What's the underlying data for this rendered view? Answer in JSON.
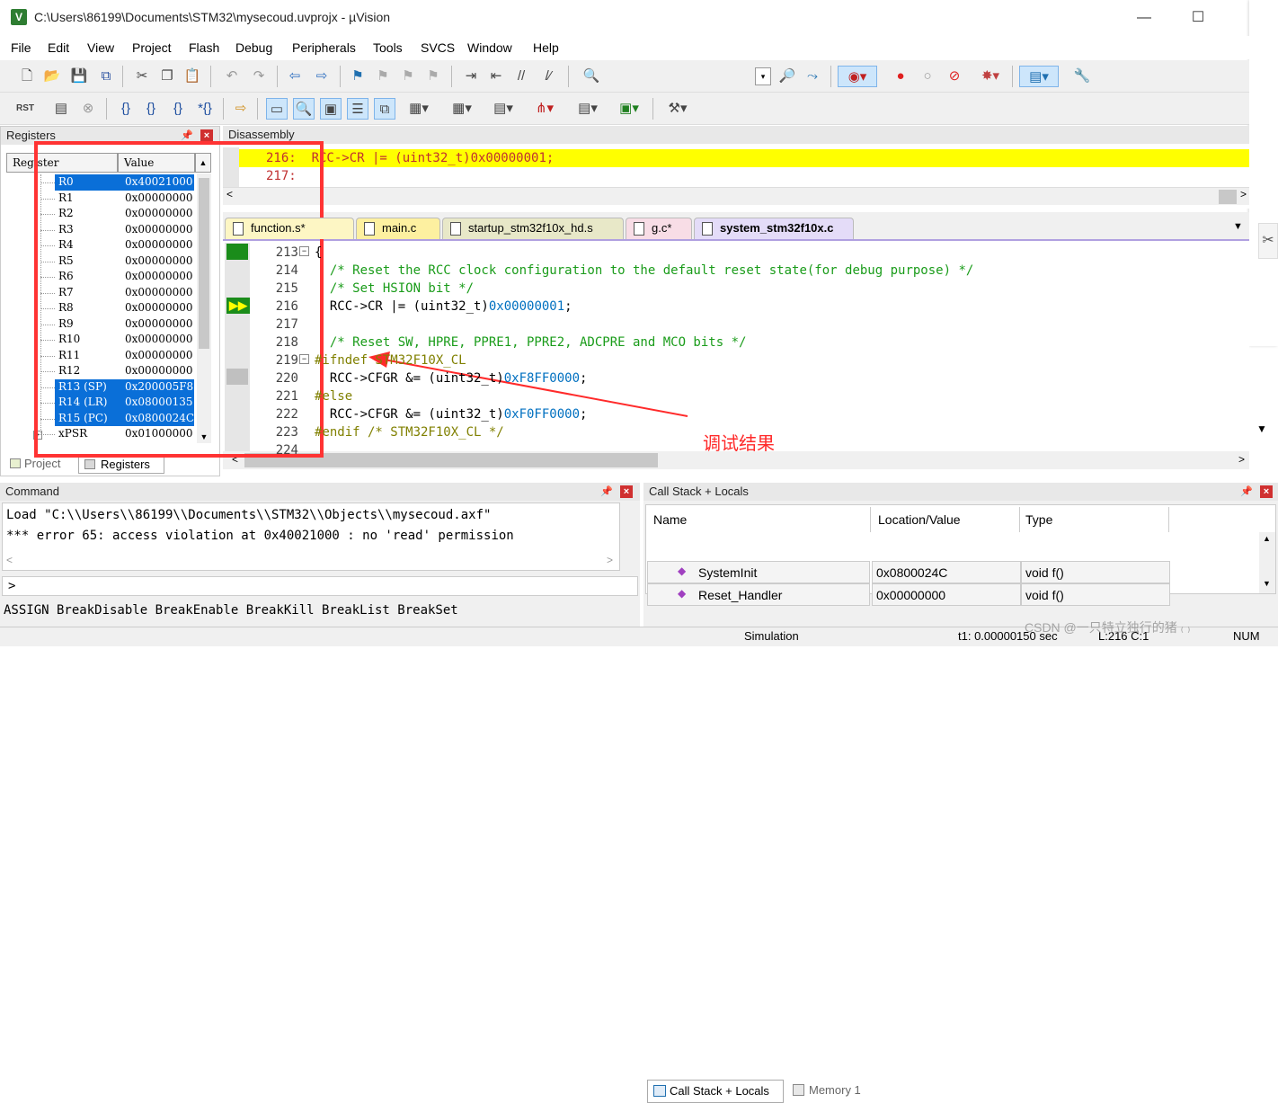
{
  "window": {
    "title": "C:\\Users\\86199\\Documents\\STM32\\mysecoud.uvprojx - µVision"
  },
  "menu": [
    "File",
    "Edit",
    "View",
    "Project",
    "Flash",
    "Debug",
    "Peripherals",
    "Tools",
    "SVCS",
    "Window",
    "Help"
  ],
  "registers": {
    "title": "Registers",
    "col_register": "Register",
    "col_value": "Value",
    "rows": [
      {
        "name": "R0",
        "value": "0x40021000",
        "selected": true
      },
      {
        "name": "R1",
        "value": "0x00000000",
        "selected": false
      },
      {
        "name": "R2",
        "value": "0x00000000",
        "selected": false
      },
      {
        "name": "R3",
        "value": "0x00000000",
        "selected": false
      },
      {
        "name": "R4",
        "value": "0x00000000",
        "selected": false
      },
      {
        "name": "R5",
        "value": "0x00000000",
        "selected": false
      },
      {
        "name": "R6",
        "value": "0x00000000",
        "selected": false
      },
      {
        "name": "R7",
        "value": "0x00000000",
        "selected": false
      },
      {
        "name": "R8",
        "value": "0x00000000",
        "selected": false
      },
      {
        "name": "R9",
        "value": "0x00000000",
        "selected": false
      },
      {
        "name": "R10",
        "value": "0x00000000",
        "selected": false
      },
      {
        "name": "R11",
        "value": "0x00000000",
        "selected": false
      },
      {
        "name": "R12",
        "value": "0x00000000",
        "selected": false
      },
      {
        "name": "R13 (SP)",
        "value": "0x200005F8",
        "selected": true
      },
      {
        "name": "R14 (LR)",
        "value": "0x08000135",
        "selected": true
      },
      {
        "name": "R15 (PC)",
        "value": "0x0800024C",
        "selected": true
      },
      {
        "name": "xPSR",
        "value": "0x01000000",
        "selected": false
      }
    ],
    "tab_project": "Project",
    "tab_registers": "Registers"
  },
  "disassembly": {
    "title": "Disassembly",
    "line1_num": "216:",
    "line1_code": "  RCC->CR |= (uint32_t)0x00000001;",
    "line2_num": "217:"
  },
  "editor_tabs": [
    {
      "label": "function.s*",
      "color": "#fdf6c4"
    },
    {
      "label": "main.c",
      "color": "#fdf0a0"
    },
    {
      "label": "startup_stm32f10x_hd.s",
      "color": "#e8e8c8"
    },
    {
      "label": "g.c*",
      "color": "#f8dde6"
    },
    {
      "label": "system_stm32f10x.c",
      "color": "#e4dcf8"
    }
  ],
  "code_lines": [
    {
      "num": "213",
      "text": "{"
    },
    {
      "num": "214",
      "text": "  /* Reset the RCC clock configuration to the default reset state(for debug purpose) */"
    },
    {
      "num": "215",
      "text": "  /* Set HSION bit */"
    },
    {
      "num": "216",
      "text": "  RCC->CR |= (uint32_t)0x00000001;"
    },
    {
      "num": "217",
      "text": ""
    },
    {
      "num": "218",
      "text": "  /* Reset SW, HPRE, PPRE1, PPRE2, ADCPRE and MCO bits */"
    },
    {
      "num": "219",
      "text": "#ifndef STM32F10X_CL"
    },
    {
      "num": "220",
      "text": "  RCC->CFGR &= (uint32_t)0xF8FF0000;"
    },
    {
      "num": "221",
      "text": "#else"
    },
    {
      "num": "222",
      "text": "  RCC->CFGR &= (uint32_t)0xF0FF0000;"
    },
    {
      "num": "223",
      "text": "#endif /* STM32F10X_CL */"
    },
    {
      "num": "224",
      "text": ""
    }
  ],
  "annotation": "调试结果",
  "command": {
    "title": "Command",
    "line1": "Load \"C:\\\\Users\\\\86199\\\\Documents\\\\STM32\\\\Objects\\\\mysecoud.axf\"",
    "line2": "*** error 65: access violation at 0x40021000 : no 'read' permission",
    "prompt": ">",
    "hints": "ASSIGN BreakDisable BreakEnable BreakKill BreakList BreakSet"
  },
  "callstack": {
    "title": "Call Stack + Locals",
    "col_name": "Name",
    "col_location": "Location/Value",
    "col_type": "Type",
    "rows": [
      {
        "name": "SystemInit",
        "location": "0x0800024C",
        "type": "void f()"
      },
      {
        "name": "Reset_Handler",
        "location": "0x00000000",
        "type": "void f()"
      }
    ],
    "tab_callstack": "Call Stack + Locals",
    "tab_memory": "Memory 1"
  },
  "status": {
    "mode": "Simulation",
    "time": "t1: 0.00000150 sec",
    "position": "L:216 C:1",
    "num": "NUM",
    "watermark": "CSDN @一只特立独行的猪 ₍ ₎"
  }
}
